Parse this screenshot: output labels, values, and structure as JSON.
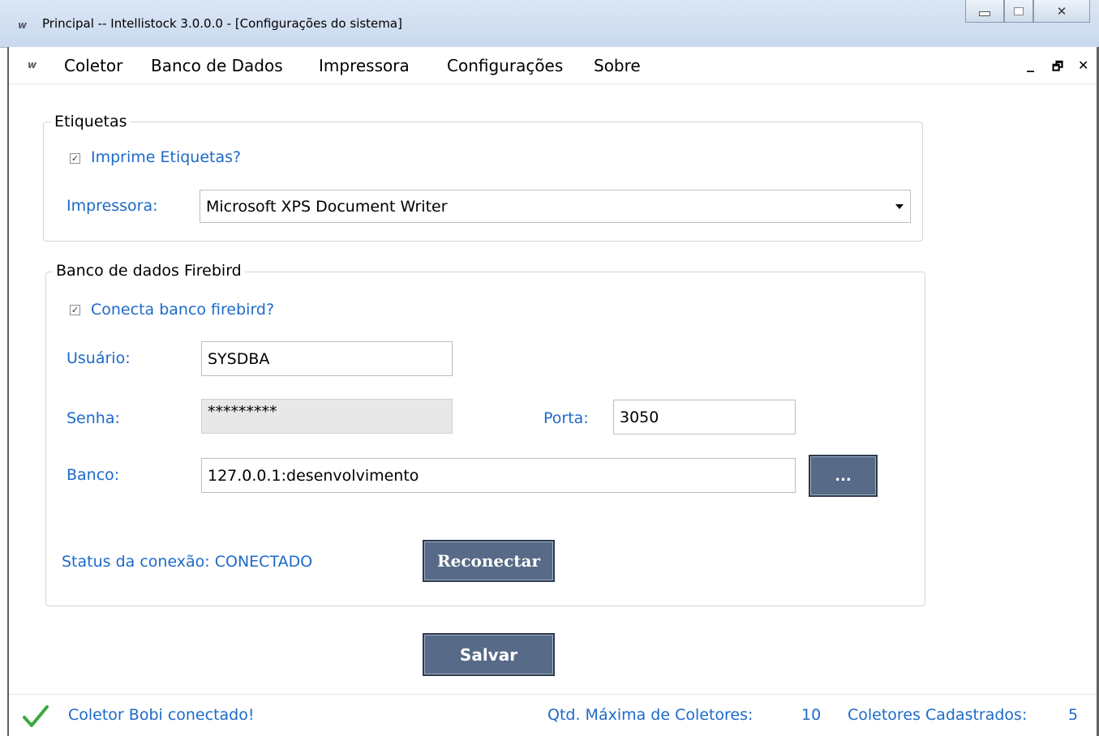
{
  "window": {
    "title": "Principal -- Intellistock 3.0.0.0 - [Configurações do sistema]",
    "logo_text": "w"
  },
  "menu": {
    "items": [
      "Coletor",
      "Banco de Dados",
      "Impressora",
      "Configurações",
      "Sobre"
    ],
    "mdi_controls": [
      "_",
      "🗗",
      "✕"
    ]
  },
  "etiquetas": {
    "group_title": "Etiquetas",
    "checkbox_label": "Imprime Etiquetas?",
    "checkbox_checked": true,
    "printer_label": "Impressora:",
    "printer_value": "Microsoft XPS Document Writer"
  },
  "firebird": {
    "group_title": "Banco de dados Firebird",
    "checkbox_label": "Conecta banco firebird?",
    "checkbox_checked": true,
    "user_label": "Usuário:",
    "user_value": "SYSDBA",
    "password_label": "Senha:",
    "password_value": "*********",
    "port_label": "Porta:",
    "port_value": "3050",
    "db_label": "Banco:",
    "db_value": "127.0.0.1:desenvolvimento",
    "browse_label": "...",
    "status_text": "Status da conexão: CONECTADO",
    "reconnect_label": "Reconectar"
  },
  "actions": {
    "save_label": "Salvar"
  },
  "statusbar": {
    "collector_status": "Coletor Bobi conectado!",
    "max_collectors_label": "Qtd. Máxima de Coletores:",
    "max_collectors_value": "10",
    "registered_label": "Coletores Cadastrados:",
    "registered_value": "5"
  },
  "colors": {
    "label_blue": "#1c6ac9",
    "button_bg": "#576a87",
    "check_green": "#3ca83c"
  }
}
